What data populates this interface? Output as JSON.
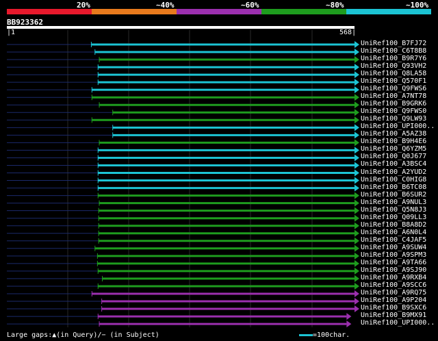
{
  "legend": {
    "labels": [
      "20%",
      "~40%",
      "~60%",
      "~80%",
      "~100%"
    ],
    "colors": [
      "#e8192c",
      "#e87a1d",
      "#9b2fae",
      "#1e9c1e",
      "#1cc4d4"
    ]
  },
  "query": {
    "name": "BB923362",
    "start": "1",
    "end": "568",
    "length": 568
  },
  "hits": [
    {
      "name": "UniRef100_B7FJ72",
      "start": 138,
      "end": 568,
      "color": "#1cc4d4"
    },
    {
      "name": "UniRef100_C6T8B8",
      "start": 144,
      "end": 568,
      "color": "#1cc4d4"
    },
    {
      "name": "UniRef100_B9R7Y6",
      "start": 151,
      "end": 568,
      "color": "#1e9c1e"
    },
    {
      "name": "UniRef100_Q93VH2",
      "start": 149,
      "end": 568,
      "color": "#1cc4d4"
    },
    {
      "name": "UniRef100_Q8LA58",
      "start": 149,
      "end": 568,
      "color": "#1cc4d4"
    },
    {
      "name": "UniRef100_Q570F1",
      "start": 149,
      "end": 568,
      "color": "#1cc4d4"
    },
    {
      "name": "UniRef100_Q9FWS6",
      "start": 139,
      "end": 568,
      "color": "#1cc4d4"
    },
    {
      "name": "UniRef100_A7NT78",
      "start": 139,
      "end": 568,
      "color": "#1e9c1e"
    },
    {
      "name": "UniRef100_B9GRK6",
      "start": 151,
      "end": 568,
      "color": "#1e9c1e"
    },
    {
      "name": "UniRef100_Q9FWS0",
      "start": 173,
      "end": 568,
      "color": "#1e9c1e"
    },
    {
      "name": "UniRef100_Q9LW93",
      "start": 139,
      "end": 568,
      "color": "#1e9c1e"
    },
    {
      "name": "UniRef100_UPI000..",
      "start": 173,
      "end": 568,
      "color": "#1cc4d4"
    },
    {
      "name": "UniRef100_A5AZ38",
      "start": 173,
      "end": 568,
      "color": "#1cc4d4"
    },
    {
      "name": "UniRef100_B9H4E6",
      "start": 151,
      "end": 568,
      "color": "#1e9c1e"
    },
    {
      "name": "UniRef100_Q6YZM5",
      "start": 149,
      "end": 568,
      "color": "#1cc4d4"
    },
    {
      "name": "UniRef100_Q0J677",
      "start": 149,
      "end": 568,
      "color": "#1cc4d4"
    },
    {
      "name": "UniRef100_A3BSC4",
      "start": 149,
      "end": 568,
      "color": "#1cc4d4"
    },
    {
      "name": "UniRef100_A2YUD2",
      "start": 149,
      "end": 568,
      "color": "#1cc4d4"
    },
    {
      "name": "UniRef100_C0HIG8",
      "start": 149,
      "end": 568,
      "color": "#1cc4d4"
    },
    {
      "name": "UniRef100_B6TC08",
      "start": 149,
      "end": 568,
      "color": "#1cc4d4"
    },
    {
      "name": "UniRef100_B6SUR2",
      "start": 149,
      "end": 568,
      "color": "#1e9c1e"
    },
    {
      "name": "UniRef100_A9NUL3",
      "start": 151,
      "end": 568,
      "color": "#1e9c1e"
    },
    {
      "name": "UniRef100_Q5N8J3",
      "start": 150,
      "end": 568,
      "color": "#1e9c1e"
    },
    {
      "name": "UniRef100_Q09LL3",
      "start": 150,
      "end": 568,
      "color": "#1e9c1e"
    },
    {
      "name": "UniRef100_B8A8D2",
      "start": 150,
      "end": 568,
      "color": "#1e9c1e"
    },
    {
      "name": "UniRef100_A6N0L4",
      "start": 150,
      "end": 568,
      "color": "#1e9c1e"
    },
    {
      "name": "UniRef100_C4JAF5",
      "start": 150,
      "end": 568,
      "color": "#1e9c1e"
    },
    {
      "name": "UniRef100_A9SUW4",
      "start": 144,
      "end": 568,
      "color": "#1e9c1e"
    },
    {
      "name": "UniRef100_A9SPM3",
      "start": 148,
      "end": 568,
      "color": "#1e9c1e"
    },
    {
      "name": "UniRef100_A9TA66",
      "start": 148,
      "end": 568,
      "color": "#1e9c1e"
    },
    {
      "name": "UniRef100_A9SJ90",
      "start": 149,
      "end": 568,
      "color": "#1e9c1e"
    },
    {
      "name": "UniRef100_A9RXB4",
      "start": 156,
      "end": 568,
      "color": "#1e9c1e"
    },
    {
      "name": "UniRef100_A9SCC6",
      "start": 149,
      "end": 568,
      "color": "#1e9c1e"
    },
    {
      "name": "UniRef100_A9RQ75",
      "start": 139,
      "end": 568,
      "color": "#9b2fae"
    },
    {
      "name": "UniRef100_A9P204",
      "start": 155,
      "end": 568,
      "color": "#9b2fae"
    },
    {
      "name": "UniRef100_B9SXC6",
      "start": 155,
      "end": 568,
      "color": "#9b2fae"
    },
    {
      "name": "UniRef100_B9MX91",
      "start": 149,
      "end": 555,
      "color": "#9b2fae"
    },
    {
      "name": "UniRef100_UPI000..",
      "start": 151,
      "end": 555,
      "color": "#9b2fae"
    }
  ],
  "footer": {
    "gaps_text": "Large gaps:▲(in Query)/− (in Subject)",
    "scale_text": "=100char."
  }
}
